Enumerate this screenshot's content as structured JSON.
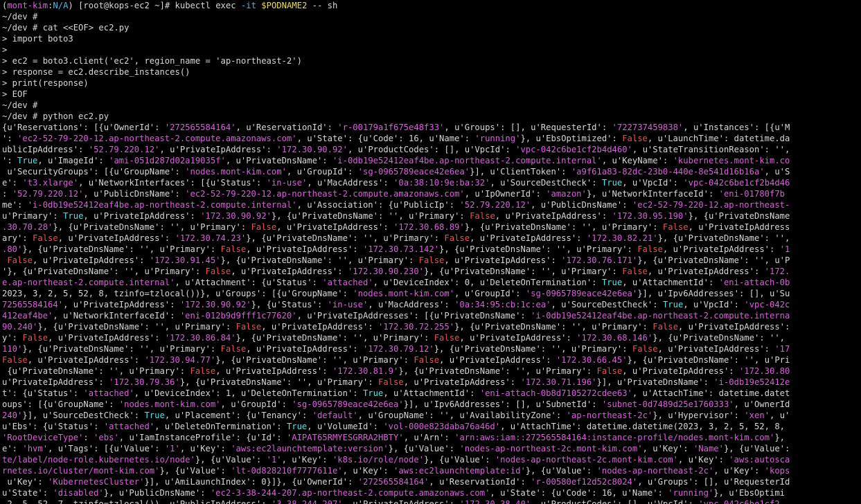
{
  "prompt": {
    "open": "(",
    "context": "mont-kim",
    "sep": ":",
    "namespace": "N/A",
    "close": ") ",
    "userhost": "[root@kops-ec2 ~]# "
  },
  "exec": {
    "cmd": "kubectl exec ",
    "flag": "-it",
    "space": " ",
    "var": "$PODNAME2",
    "rest": " -- sh"
  },
  "plain_lines": [
    "~/dev #",
    "~/dev # cat <<EOF> ec2.py",
    "> import boto3",
    ">",
    "> ec2 = boto3.client('ec2', region_name = 'ap-northeast-2')",
    "> response = ec2.describe_instances()",
    "> print(response)",
    "> EOF",
    "~/dev #",
    "~/dev # python ec2.py"
  ],
  "output_lines": [
    [
      [
        "n",
        "{u'Reservations': [{u'OwnerId': "
      ],
      [
        "s",
        "'272565584164'"
      ],
      [
        "n",
        ", u'ReservationId': "
      ],
      [
        "s",
        "'r-00179a1f675e48f33'"
      ],
      [
        "n",
        ", u'Groups': [], u'RequesterId': "
      ],
      [
        "s",
        "'722737459838'"
      ],
      [
        "n",
        ", u'Instances': [{u'M"
      ]
    ],
    [
      [
        "n",
        "': "
      ],
      [
        "s",
        "'ec2-52-79-220-12.ap-northeast-2.compute.amazonaws.com'"
      ],
      [
        "n",
        ", u'State': {u'Code': 16, u'Name': "
      ],
      [
        "s",
        "'running'"
      ],
      [
        "n",
        "}, u'EbsOptimized': "
      ],
      [
        "f",
        "False"
      ],
      [
        "n",
        ", u'LaunchTime': datetime.da"
      ]
    ],
    [
      [
        "n",
        "ublicIpAddress': "
      ],
      [
        "s",
        "'52.79.220.12'"
      ],
      [
        "n",
        ", u'PrivateIpAddress': "
      ],
      [
        "s",
        "'172.30.90.92'"
      ],
      [
        "n",
        ", u'ProductCodes': [], u'VpcId': "
      ],
      [
        "s",
        "'vpc-042c6be1cf2b4d460'"
      ],
      [
        "n",
        ", u'StateTransitionReason': '',"
      ]
    ],
    [
      [
        "n",
        "': "
      ],
      [
        "t",
        "True"
      ],
      [
        "n",
        ", u'ImageId': "
      ],
      [
        "s",
        "'ami-051d287d02a19035f'"
      ],
      [
        "n",
        ", u'PrivateDnsName': "
      ],
      [
        "s",
        "'i-0db19e52412eaf4be.ap-northeast-2.compute.internal'"
      ],
      [
        "n",
        ", u'KeyName': "
      ],
      [
        "s",
        "'kubernetes.mont-kim.co"
      ]
    ],
    [
      [
        "n",
        " u'SecurityGroups': [{u'GroupName': "
      ],
      [
        "s",
        "'nodes.mont-kim.com'"
      ],
      [
        "n",
        ", u'GroupId': "
      ],
      [
        "s",
        "'sg-0965789eace42e6ea'"
      ],
      [
        "n",
        "}], u'ClientToken': "
      ],
      [
        "s",
        "'a9f61a83-82dc-23b0-440e-8e541d16b16a'"
      ],
      [
        "n",
        ", u'S"
      ]
    ],
    [
      [
        "n",
        "e': "
      ],
      [
        "s",
        "'t3.xlarge'"
      ],
      [
        "n",
        ", u'NetworkInterfaces': [{u'Status': "
      ],
      [
        "s",
        "'in-use'"
      ],
      [
        "n",
        ", u'MacAddress': "
      ],
      [
        "s",
        "'0a:38:10:9e:ba:32'"
      ],
      [
        "n",
        ", u'SourceDestCheck': "
      ],
      [
        "t",
        "True"
      ],
      [
        "n",
        ", u'VpcId': "
      ],
      [
        "s",
        "'vpc-042c6be1cf2b4d46"
      ]
    ],
    [
      [
        "n",
        ": "
      ],
      [
        "s",
        "'52.79.220.12'"
      ],
      [
        "n",
        ", u'PublicDnsName': "
      ],
      [
        "s",
        "'ec2-52-79-220-12.ap-northeast-2.compute.amazonaws.com'"
      ],
      [
        "n",
        ", u'IpOwnerId': "
      ],
      [
        "s",
        "'amazon'"
      ],
      [
        "n",
        "}, u'NetworkInterfaceId': "
      ],
      [
        "s",
        "'eni-01780f7b"
      ]
    ],
    [
      [
        "n",
        "me': "
      ],
      [
        "s",
        "'i-0db19e52412eaf4be.ap-northeast-2.compute.internal'"
      ],
      [
        "n",
        ", u'Association': {u'PublicIp': "
      ],
      [
        "s",
        "'52.79.220.12'"
      ],
      [
        "n",
        ", u'PublicDnsName': "
      ],
      [
        "s",
        "'ec2-52-79-220-12.ap-northeast-"
      ]
    ],
    [
      [
        "n",
        "u'Primary': "
      ],
      [
        "t",
        "True"
      ],
      [
        "n",
        ", u'PrivateIpAddress': "
      ],
      [
        "s",
        "'172.30.90.92'"
      ],
      [
        "n",
        "}, {u'PrivateDnsName': '', u'Primary': "
      ],
      [
        "f",
        "False"
      ],
      [
        "n",
        ", u'PrivateIpAddress': "
      ],
      [
        "s",
        "'172.30.95.190'"
      ],
      [
        "n",
        "}, {u'PrivateDnsName"
      ]
    ],
    [
      [
        "s",
        ".30.70.28'"
      ],
      [
        "n",
        "}, {u'PrivateDnsName': '', u'Primary': "
      ],
      [
        "f",
        "False"
      ],
      [
        "n",
        ", u'PrivateIpAddress': "
      ],
      [
        "s",
        "'172.30.68.89'"
      ],
      [
        "n",
        "}, {u'PrivateDnsName': '', u'Primary': "
      ],
      [
        "f",
        "False"
      ],
      [
        "n",
        ", u'PrivateIpAddress"
      ]
    ],
    [
      [
        "n",
        "ary': "
      ],
      [
        "f",
        "False"
      ],
      [
        "n",
        ", u'PrivateIpAddress': "
      ],
      [
        "s",
        "'172.30.74.23'"
      ],
      [
        "n",
        "}, {u'PrivateDnsName': '', u'Primary': "
      ],
      [
        "f",
        "False"
      ],
      [
        "n",
        ", u'PrivateIpAddress': "
      ],
      [
        "s",
        "'172.30.82.21'"
      ],
      [
        "n",
        "}, {u'PrivateDnsName': '',"
      ]
    ],
    [
      [
        "s",
        ".80'"
      ],
      [
        "n",
        "}, {u'PrivateDnsName': '', u'Primary': "
      ],
      [
        "f",
        "False"
      ],
      [
        "n",
        ", u'PrivateIpAddress': "
      ],
      [
        "s",
        "'172.30.73.142'"
      ],
      [
        "n",
        "}, {u'PrivateDnsName': '', u'Primary': "
      ],
      [
        "f",
        "False"
      ],
      [
        "n",
        ", u'PrivateIpAddress': "
      ],
      [
        "s",
        "'1"
      ]
    ],
    [
      [
        "f",
        " False"
      ],
      [
        "n",
        ", u'PrivateIpAddress': "
      ],
      [
        "s",
        "'172.30.91.45'"
      ],
      [
        "n",
        "}, {u'PrivateDnsName': '', u'Primary': "
      ],
      [
        "f",
        "False"
      ],
      [
        "n",
        ", u'PrivateIpAddress': "
      ],
      [
        "s",
        "'172.30.76.171'"
      ],
      [
        "n",
        "}, {u'PrivateDnsName': '', u'P"
      ]
    ],
    [
      [
        "n",
        "'}, {u'PrivateDnsName': '', u'Primary': "
      ],
      [
        "f",
        "False"
      ],
      [
        "n",
        ", u'PrivateIpAddress': "
      ],
      [
        "s",
        "'172.30.90.230'"
      ],
      [
        "n",
        "}, {u'PrivateDnsName': '', u'Primary': "
      ],
      [
        "f",
        "False"
      ],
      [
        "n",
        ", u'PrivateIpAddress': "
      ],
      [
        "s",
        "'172."
      ]
    ],
    [
      [
        "s",
        "e.ap-northeast-2.compute.internal'"
      ],
      [
        "n",
        ", u'Attachment': {u'Status': "
      ],
      [
        "s",
        "'attached'"
      ],
      [
        "n",
        ", u'DeviceIndex': 0, u'DeleteOnTermination': "
      ],
      [
        "t",
        "True"
      ],
      [
        "n",
        ", u'AttachmentId': "
      ],
      [
        "s",
        "'eni-attach-0b"
      ]
    ],
    [
      [
        "n",
        "2023, 3, 2, 5, 52, 8, tzinfo=tzlocal())}, u'Groups': [{u'GroupName': "
      ],
      [
        "s",
        "'nodes.mont-kim.com'"
      ],
      [
        "n",
        ", u'GroupId': "
      ],
      [
        "s",
        "'sg-0965789eace42e6ea'"
      ],
      [
        "n",
        "}], u'Ipv6Addresses': [], u'Su"
      ]
    ],
    [
      [
        "s",
        "72565584164'"
      ],
      [
        "n",
        ", u'PrivateIpAddress': "
      ],
      [
        "s",
        "'172.30.90.92'"
      ],
      [
        "n",
        "}, {u'Status': "
      ],
      [
        "s",
        "'in-use'"
      ],
      [
        "n",
        ", u'MacAddress': "
      ],
      [
        "s",
        "'0a:34:95:cb:1c:ea'"
      ],
      [
        "n",
        ", u'SourceDestCheck': "
      ],
      [
        "t",
        "True"
      ],
      [
        "n",
        ", u'VpcId': "
      ],
      [
        "s",
        "'vpc-042c"
      ]
    ],
    [
      [
        "s",
        "412eaf4be'"
      ],
      [
        "n",
        ", u'NetworkInterfaceId': "
      ],
      [
        "s",
        "'eni-012b9d9fff1c77620'"
      ],
      [
        "n",
        ", u'PrivateIpAddresses': [{u'PrivateDnsName': "
      ],
      [
        "s",
        "'i-0db19e52412eaf4be.ap-northeast-2.compute.interna"
      ]
    ],
    [
      [
        "s",
        "90.240'"
      ],
      [
        "n",
        "}, {u'PrivateDnsName': '', u'Primary': "
      ],
      [
        "f",
        "False"
      ],
      [
        "n",
        ", u'PrivateIpAddress': "
      ],
      [
        "s",
        "'172.30.72.255'"
      ],
      [
        "n",
        "}, {u'PrivateDnsName': '', u'Primary': "
      ],
      [
        "f",
        "False"
      ],
      [
        "n",
        ", u'PrivateIpAddress':"
      ]
    ],
    [
      [
        "n",
        "y': "
      ],
      [
        "f",
        "False"
      ],
      [
        "n",
        ", u'PrivateIpAddress': "
      ],
      [
        "s",
        "'172.30.86.84'"
      ],
      [
        "n",
        "}, {u'PrivateDnsName': '', u'Primary': "
      ],
      [
        "f",
        "False"
      ],
      [
        "n",
        ", u'PrivateIpAddress': "
      ],
      [
        "s",
        "'172.30.68.146'"
      ],
      [
        "n",
        "}, {u'PrivateDnsName': '',"
      ]
    ],
    [
      [
        "s",
        "110'"
      ],
      [
        "n",
        "}, {u'PrivateDnsName': '', u'Primary': "
      ],
      [
        "f",
        "False"
      ],
      [
        "n",
        ", u'PrivateIpAddress': "
      ],
      [
        "s",
        "'172.30.79.12'"
      ],
      [
        "n",
        "}, {u'PrivateDnsName': '', u'Primary': "
      ],
      [
        "f",
        "False"
      ],
      [
        "n",
        ", u'PrivateIpAddress': "
      ],
      [
        "s",
        "'17"
      ]
    ],
    [
      [
        "f",
        "False"
      ],
      [
        "n",
        ", u'PrivateIpAddress': "
      ],
      [
        "s",
        "'172.30.94.77'"
      ],
      [
        "n",
        "}, {u'PrivateDnsName': '', u'Primary': "
      ],
      [
        "f",
        "False"
      ],
      [
        "n",
        ", u'PrivateIpAddress': "
      ],
      [
        "s",
        "'172.30.66.45'"
      ],
      [
        "n",
        "}, {u'PrivateDnsName': '', u'Pri"
      ]
    ],
    [
      [
        "n",
        " {u'PrivateDnsName': '', u'Primary': "
      ],
      [
        "f",
        "False"
      ],
      [
        "n",
        ", u'PrivateIpAddress': "
      ],
      [
        "s",
        "'172.30.81.9'"
      ],
      [
        "n",
        "}, {u'PrivateDnsName': '', u'Primary': "
      ],
      [
        "f",
        "False"
      ],
      [
        "n",
        ", u'PrivateIpAddress': "
      ],
      [
        "s",
        "'172.30.80"
      ]
    ],
    [
      [
        "n",
        "u'PrivateIpAddress': "
      ],
      [
        "s",
        "'172.30.79.36'"
      ],
      [
        "n",
        "}, {u'PrivateDnsName': '', u'Primary': "
      ],
      [
        "f",
        "False"
      ],
      [
        "n",
        ", u'PrivateIpAddress': "
      ],
      [
        "s",
        "'172.30.71.196'"
      ],
      [
        "n",
        "}], u'PrivateDnsName': "
      ],
      [
        "s",
        "'i-0db19e52412e"
      ]
    ],
    [
      [
        "n",
        "t': {u'Status': "
      ],
      [
        "s",
        "'attached'"
      ],
      [
        "n",
        ", u'DeviceIndex': 1, u'DeleteOnTermination': "
      ],
      [
        "t",
        "True"
      ],
      [
        "n",
        ", u'AttachmentId': "
      ],
      [
        "s",
        "'eni-attach-0b8d7105272cdee63'"
      ],
      [
        "n",
        ", u'AttachTime': datetime.datet"
      ]
    ],
    [
      [
        "n",
        "oups': [{u'GroupName': "
      ],
      [
        "s",
        "'nodes.mont-kim.com'"
      ],
      [
        "n",
        ", u'GroupId': "
      ],
      [
        "s",
        "'sg-0965789eace42e6ea'"
      ],
      [
        "n",
        "}], u'Ipv6Addresses': [], u'SubnetId': "
      ],
      [
        "s",
        "'subnet-0d7489d25e1760333'"
      ],
      [
        "n",
        ", u'OwnerId"
      ]
    ],
    [
      [
        "s",
        "240'"
      ],
      [
        "n",
        "}], u'SourceDestCheck': "
      ],
      [
        "t",
        "True"
      ],
      [
        "n",
        ", u'Placement': {u'Tenancy': "
      ],
      [
        "s",
        "'default'"
      ],
      [
        "n",
        ", u'GroupName': '', u'AvailabilityZone': "
      ],
      [
        "s",
        "'ap-northeast-2c'"
      ],
      [
        "n",
        "}, u'Hypervisor': "
      ],
      [
        "s",
        "'xen'"
      ],
      [
        "n",
        ", u'"
      ]
    ],
    [
      [
        "n",
        "u'Ebs': {u'Status': "
      ],
      [
        "s",
        "'attached'"
      ],
      [
        "n",
        ", u'DeleteOnTermination': "
      ],
      [
        "t",
        "True"
      ],
      [
        "n",
        ", u'VolumeId': "
      ],
      [
        "s",
        "'vol-000e823daba76a46d'"
      ],
      [
        "n",
        ", u'AttachTime': datetime.datetime(2023, 3, 2, 5, 52, 8,"
      ]
    ],
    [
      [
        "s",
        "'RootDeviceType'"
      ],
      [
        "n",
        ": "
      ],
      [
        "s",
        "'ebs'"
      ],
      [
        "n",
        ", u'IamInstanceProfile': {u'Id': "
      ],
      [
        "s",
        "'AIPAT65RMYESGRRA2HBTY'"
      ],
      [
        "n",
        ", u'Arn': "
      ],
      [
        "s",
        "'arn:aws:iam::272565584164:instance-profile/nodes.mont-kim.com'"
      ],
      [
        "n",
        "},"
      ]
    ],
    [
      [
        "n",
        "e': "
      ],
      [
        "s",
        "'hvm'"
      ],
      [
        "n",
        ", u'Tags': [{u'Value': "
      ],
      [
        "s",
        "'1'"
      ],
      [
        "n",
        ", u'Key': "
      ],
      [
        "s",
        "'aws:ec2launchtemplate:version'"
      ],
      [
        "n",
        "}, {u'Value': "
      ],
      [
        "s",
        "'nodes-ap-northeast-2c.mont-kim.com'"
      ],
      [
        "n",
        ", u'Key': "
      ],
      [
        "s",
        "'Name'"
      ],
      [
        "n",
        "}, {u'Value':"
      ]
    ],
    [
      [
        "s",
        "te/label/node-role.kubernetes.io/node'"
      ],
      [
        "n",
        "}, {u'Value': "
      ],
      [
        "s",
        "'1'"
      ],
      [
        "n",
        ", u'Key': "
      ],
      [
        "s",
        "'k8s.io/role/node'"
      ],
      [
        "n",
        "}, {u'Value': "
      ],
      [
        "s",
        "'nodes-ap-northeast-2c.mont-kim.com'"
      ],
      [
        "n",
        ", u'Key': "
      ],
      [
        "s",
        "'aws:autosca"
      ]
    ],
    [
      [
        "s",
        "rnetes.io/cluster/mont-kim.com'"
      ],
      [
        "n",
        "}, {u'Value': "
      ],
      [
        "s",
        "'lt-0d828210f7777611e'"
      ],
      [
        "n",
        ", u'Key': "
      ],
      [
        "s",
        "'aws:ec2launchtemplate:id'"
      ],
      [
        "n",
        "}, {u'Value': "
      ],
      [
        "s",
        "'nodes-ap-northeast-2c'"
      ],
      [
        "n",
        ", u'Key': "
      ],
      [
        "s",
        "'kops"
      ]
    ],
    [
      [
        "n",
        " u'Key': "
      ],
      [
        "s",
        "'KubernetesCluster'"
      ],
      [
        "n",
        "}], u'AmiLaunchIndex': 0}]}, {u'OwnerId': "
      ],
      [
        "s",
        "'272565584164'"
      ],
      [
        "n",
        ", u'ReservationId': "
      ],
      [
        "s",
        "'r-00580ef12d52c8024'"
      ],
      [
        "n",
        ", u'Groups': [], u'RequesterId"
      ]
    ],
    [
      [
        "n",
        "u'State': "
      ],
      [
        "s",
        "'disabled'"
      ],
      [
        "n",
        "}, u'PublicDnsName': "
      ],
      [
        "s",
        "'ec2-3-38-244-207.ap-northeast-2.compute.amazonaws.com'"
      ],
      [
        "n",
        ", u'State': {u'Code': 16, u'Name': "
      ],
      [
        "s",
        "'running'"
      ],
      [
        "n",
        "}, u'EbsOptimi"
      ]
    ],
    [
      [
        "n",
        " 2, 5, 52, 7, tzinfo=tzlocal()), u'PublicIpAddress': "
      ],
      [
        "s",
        "'3.38.244.207'"
      ],
      [
        "n",
        ", u'PrivateIpAddress': "
      ],
      [
        "s",
        "'172.30.38.40'"
      ],
      [
        "n",
        ", u'ProductCodes': [], u'VpcId': "
      ],
      [
        "s",
        "'vpc-042c6be1cf2"
      ]
    ]
  ]
}
